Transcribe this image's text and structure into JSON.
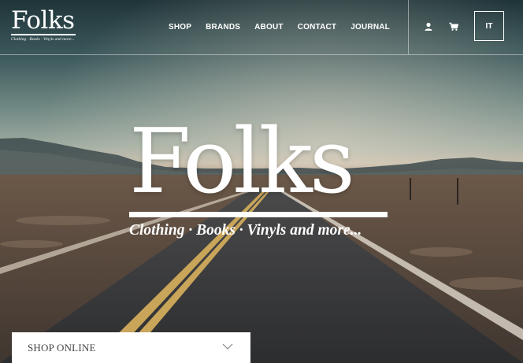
{
  "header": {
    "logo": {
      "title": "Folks",
      "subtitle": "Clothing · Books · Vinyls and more..."
    },
    "nav": [
      {
        "label": "SHOP"
      },
      {
        "label": "BRANDS"
      },
      {
        "label": "ABOUT"
      },
      {
        "label": "CONTACT"
      },
      {
        "label": "JOURNAL"
      }
    ],
    "icons": [
      "user-icon",
      "cart-icon"
    ],
    "language": "IT"
  },
  "hero": {
    "title": "Folks",
    "tagline": "Clothing · Books · Vinyls and more..."
  },
  "shop_dropdown": {
    "label": "SHOP ONLINE",
    "icon": "chevron-down-icon"
  }
}
